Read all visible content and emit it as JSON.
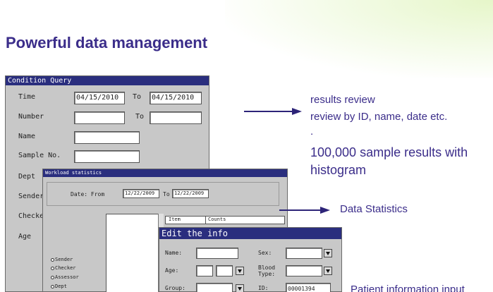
{
  "slide_title": "Powerful data management",
  "condition_query": {
    "title": "Condition Query",
    "time_label": "Time",
    "time_from": "04/15/2010",
    "to_label": "To",
    "time_to": "04/15/2010",
    "number_label": "Number",
    "number_to_label": "To",
    "name_label": "Name",
    "sample_no_label": "Sample No.",
    "dept_label": "Dept",
    "sender_label": "Sender",
    "checker_label": "Checker",
    "age_label": "Age"
  },
  "workload": {
    "title": "Workload statistics",
    "date_from_label": "Date: From",
    "date_from": "12/22/2009",
    "to_label": "To",
    "date_to": "12/22/2009",
    "col_item": "Item",
    "col_counts": "Counts",
    "radio_options": [
      "Sender",
      "Checker",
      "Assessor",
      "Dept"
    ]
  },
  "edit_info": {
    "title": "Edit the info",
    "name_label": "Name:",
    "sex_label": "Sex:",
    "age_label": "Age:",
    "blood_type_label": "Blood Type:",
    "group_label": "Group:",
    "id_label": "ID:",
    "id_value": "00001394"
  },
  "annotations": {
    "results_review": "results review",
    "review_by": "review by ID, name, date etc.",
    "dot": ".",
    "sample_results": "100,000 sample results with",
    "histogram": "histogram",
    "data_statistics": "Data Statistics",
    "patient_info": "Patient information input"
  },
  "colors": {
    "title": "#3b2d8a",
    "window_title_bar": "#2a2e7e",
    "window_body": "#c8c8c8",
    "arrow": "#2d2478"
  }
}
